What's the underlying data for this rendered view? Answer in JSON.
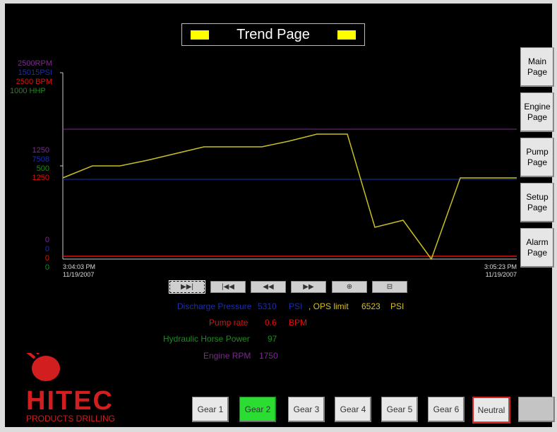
{
  "header": {
    "title": "Trend Page"
  },
  "colors": {
    "rpm": "#7a2b8c",
    "psi": "#1b2fb0",
    "bpm": "#e01010",
    "hhp": "#1f8a1f",
    "trend": "#c8c020"
  },
  "nav": [
    {
      "label": "Main\nPage"
    },
    {
      "label": "Engine\nPage"
    },
    {
      "label": "Pump\nPage"
    },
    {
      "label": "Setup\nPage"
    },
    {
      "label": "Alarm\nPage"
    }
  ],
  "axis": {
    "top": [
      "2500RPM",
      "15015PSI",
      "2500  BPM",
      "1000 HHP"
    ],
    "mid": [
      "1250",
      "7508",
      "500",
      "1250"
    ],
    "bottom": [
      "0",
      "0",
      "0",
      "0"
    ]
  },
  "time": {
    "start": "3:04:03 PM",
    "start_date": "11/19/2007",
    "end": "3:05:23 PM",
    "end_date": "11/19/2007"
  },
  "controls": [
    "▶▶|",
    "|◀◀",
    "◀◀",
    "▶▶",
    "⊕",
    "⊟"
  ],
  "readouts": {
    "pressure_label": "Discharge Pressure",
    "pressure_value": "5310",
    "pressure_unit": "PSI",
    "ops_label": ", OPS limit",
    "ops_value": "6523",
    "ops_unit": "PSI",
    "rate_label": "Pump rate",
    "rate_value": "0.6",
    "rate_unit": "BPM",
    "hhp_label": "Hydraulic Horse Power",
    "hhp_value": "97",
    "rpm_label": "Engine RPM",
    "rpm_value": "1750"
  },
  "gears": [
    "Gear 1",
    "Gear 2",
    "Gear 3",
    "Gear 4",
    "Gear 5",
    "Gear 6",
    "Neutral"
  ],
  "logo": {
    "brand": "HITEC",
    "sub": "PRODUCTS DRILLING"
  }
}
